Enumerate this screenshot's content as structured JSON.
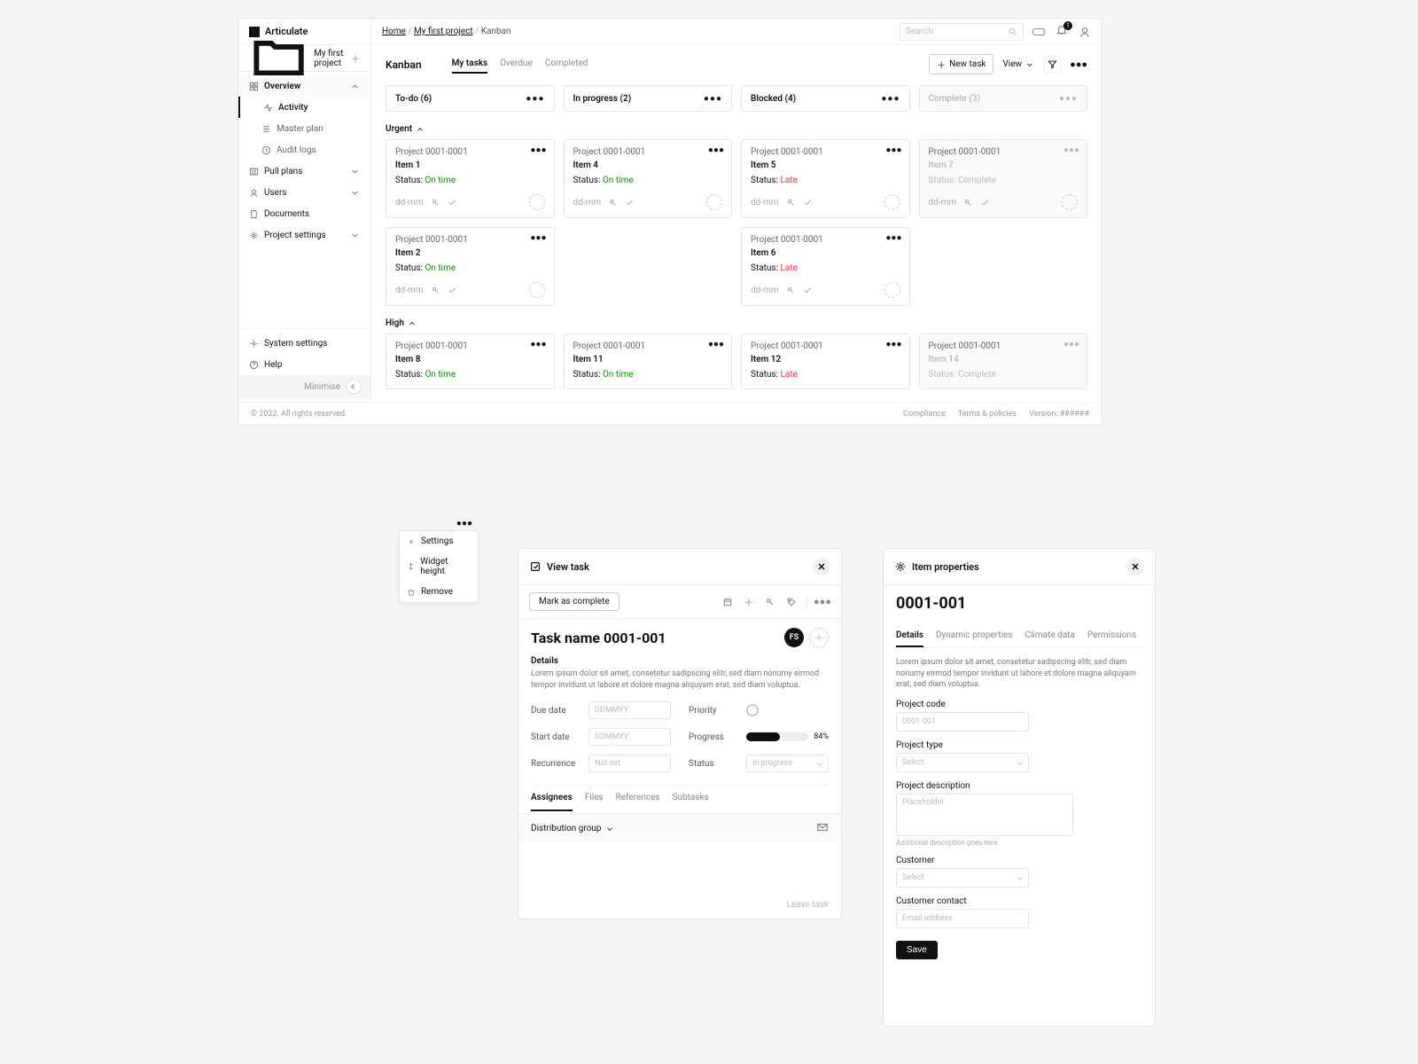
{
  "brand": "Articulate",
  "breadcrumbs": {
    "home": "Home",
    "project": "My first project",
    "current": "Kanban"
  },
  "search": {
    "placeholder": "Search"
  },
  "notifications": {
    "count": "1"
  },
  "sidebar": {
    "project_name": "My first project",
    "overview": "Overview",
    "activity": "Activity",
    "master_plan": "Master plan",
    "audit_logs": "Audit logs",
    "pull_plans": "Pull plans",
    "users": "Users",
    "documents": "Documents",
    "project_settings": "Project settings",
    "system_settings": "System settings",
    "help": "Help",
    "minimise": "Minimise"
  },
  "kanban": {
    "title": "Kanban",
    "tabs": [
      "My tasks",
      "Overdue",
      "Completed"
    ],
    "new_task": "New task",
    "view": "View",
    "columns": [
      {
        "label": "To-do (6)"
      },
      {
        "label": "In progress (2)"
      },
      {
        "label": "Blocked (4)"
      },
      {
        "label": "Complete (3)",
        "muted": true
      }
    ],
    "sections": {
      "urgent": "Urgent",
      "high": "High"
    }
  },
  "cards": {
    "proj_ref": "Project 0001-0001",
    "status_label": "Status:",
    "ontime": "On time",
    "late": "Late",
    "complete": "Complete",
    "date": "dd-mm",
    "items": {
      "i1": "Item 1",
      "i2": "Item 2",
      "i4": "Item 4",
      "i5": "Item 5",
      "i6": "Item 6",
      "i7": "Item 7",
      "i8": "Item 8",
      "i11": "Item 11",
      "i12": "Item 12",
      "i14": "Item 14"
    }
  },
  "footer": {
    "copyright": "© 2022. All rights reserved.",
    "compliance": "Compliance",
    "terms": "Terms & policies",
    "version": "Version: ######"
  },
  "ctx": {
    "settings": "Settings",
    "widget_height": "Widget height",
    "remove": "Remove"
  },
  "task": {
    "header": "View task",
    "mark_complete": "Mark as complete",
    "title": "Task name 0001-001",
    "avatar": "FS",
    "details": "Details",
    "lorem": "Lorem ipsum dolor sit amet, consetetur sadipscing elitr, sed diam nonumy eirmod tempor invidunt ut labore et dolore magna aliquyam erat, sed diam voluptua.",
    "due_date": "Due date",
    "start_date": "Start date",
    "recurrence": "Recurrence",
    "priority": "Priority",
    "progress": "Progress",
    "status": "Status",
    "date_ph": "DDMMYY",
    "rec_ph": "Not set",
    "status_ph": "In progress",
    "progress_val": "84%",
    "tabs": [
      "Assignees",
      "Files",
      "References",
      "Subtasks"
    ],
    "dist_group": "Distribution group",
    "leave": "Leave task"
  },
  "props": {
    "header": "Item properties",
    "id": "0001-001",
    "tabs": [
      "Details",
      "Dynamic properties",
      "Climate data",
      "Permissions"
    ],
    "lorem": "Lorem ipsum dolor sit amet, consetetur sadipscing elitr, sed diam nonumy eirmod tempor invidunt ut labore et dolore magna aliquyam erat, sed diam voluptua.",
    "project_code": "Project code",
    "project_code_ph": "0001-001",
    "project_type": "Project type",
    "select_ph": "Select",
    "project_desc": "Project description",
    "desc_ph": "Placeholder",
    "desc_hint": "Additional description goes here",
    "customer": "Customer",
    "customer_contact": "Customer contact",
    "email_ph": "Email address",
    "save": "Save"
  }
}
